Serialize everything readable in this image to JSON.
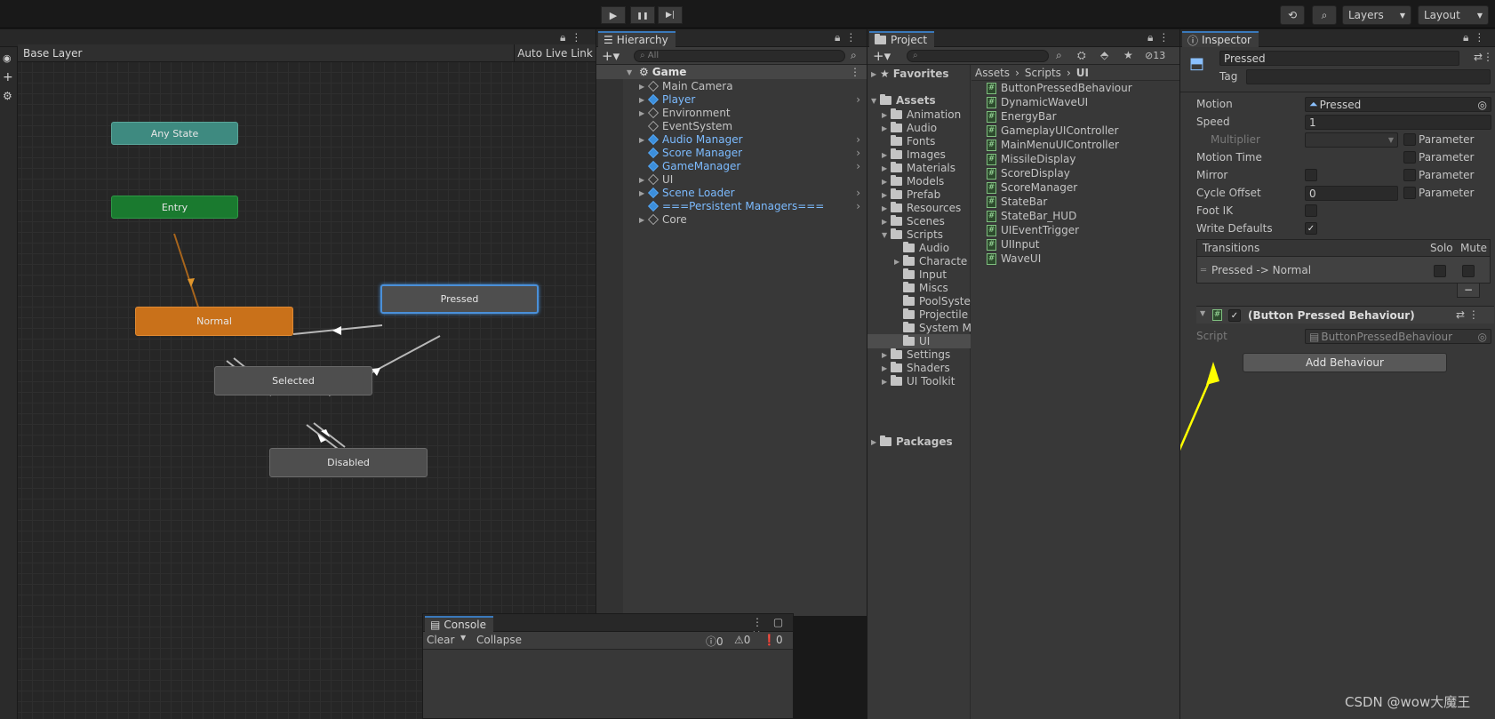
{
  "toolbar": {
    "play": "▶",
    "pause": "❚❚",
    "step": "▶|",
    "layers_label": "Layers",
    "layout_label": "Layout"
  },
  "animator": {
    "breadcrumb": "Base Layer",
    "auto_live_link": "Auto Live Link",
    "states": {
      "any_state": "Any State",
      "entry": "Entry",
      "normal": "Normal",
      "pressed": "Pressed",
      "selected": "Selected",
      "disabled": "Disabled"
    }
  },
  "hierarchy": {
    "tab": "Hierarchy",
    "search_placeholder": "All",
    "scene": "Game",
    "items": [
      {
        "label": "Main Camera",
        "prefab": false,
        "expandable": true,
        "has_arrow": false
      },
      {
        "label": "Player",
        "prefab": true,
        "expandable": true,
        "has_arrow": true
      },
      {
        "label": "Environment",
        "prefab": false,
        "expandable": true,
        "has_arrow": false
      },
      {
        "label": "EventSystem",
        "prefab": false,
        "expandable": false,
        "has_arrow": false
      },
      {
        "label": "Audio Manager",
        "prefab": true,
        "expandable": true,
        "has_arrow": true
      },
      {
        "label": "Score Manager",
        "prefab": true,
        "expandable": false,
        "has_arrow": true
      },
      {
        "label": "GameManager",
        "prefab": true,
        "expandable": false,
        "has_arrow": true
      },
      {
        "label": "UI",
        "prefab": false,
        "expandable": true,
        "has_arrow": false
      },
      {
        "label": "Scene Loader",
        "prefab": true,
        "expandable": true,
        "has_arrow": true
      },
      {
        "label": "===Persistent Managers===",
        "prefab": true,
        "expandable": false,
        "has_arrow": true
      },
      {
        "label": "Core",
        "prefab": false,
        "expandable": true,
        "has_arrow": false
      }
    ]
  },
  "project": {
    "tab": "Project",
    "hidden_count": "13",
    "favorites": "Favorites",
    "assets": "Assets",
    "folders": [
      {
        "label": "Animation",
        "indent": 1,
        "expandable": true
      },
      {
        "label": "Audio",
        "indent": 1,
        "expandable": true
      },
      {
        "label": "Fonts",
        "indent": 1,
        "expandable": false
      },
      {
        "label": "Images",
        "indent": 1,
        "expandable": true
      },
      {
        "label": "Materials",
        "indent": 1,
        "expandable": true
      },
      {
        "label": "Models",
        "indent": 1,
        "expandable": true
      },
      {
        "label": "Prefab",
        "indent": 1,
        "expandable": true
      },
      {
        "label": "Resources",
        "indent": 1,
        "expandable": true
      },
      {
        "label": "Scenes",
        "indent": 1,
        "expandable": true
      },
      {
        "label": "Scripts",
        "indent": 1,
        "expandable": true,
        "open": true
      },
      {
        "label": "Audio",
        "indent": 2,
        "expandable": false
      },
      {
        "label": "Characte",
        "indent": 2,
        "expandable": true
      },
      {
        "label": "Input",
        "indent": 2,
        "expandable": false
      },
      {
        "label": "Miscs",
        "indent": 2,
        "expandable": false
      },
      {
        "label": "PoolSyste",
        "indent": 2,
        "expandable": false
      },
      {
        "label": "Projectile",
        "indent": 2,
        "expandable": false
      },
      {
        "label": "System M",
        "indent": 2,
        "expandable": false
      },
      {
        "label": "UI",
        "indent": 2,
        "expandable": false,
        "selected": true
      },
      {
        "label": "Settings",
        "indent": 1,
        "expandable": true
      },
      {
        "label": "Shaders",
        "indent": 1,
        "expandable": true
      },
      {
        "label": "UI Toolkit",
        "indent": 1,
        "expandable": true
      }
    ],
    "packages": "Packages",
    "breadcrumb": [
      "Assets",
      "Scripts",
      "UI"
    ],
    "files": [
      "ButtonPressedBehaviour",
      "DynamicWaveUI",
      "EnergyBar",
      "GameplayUIController",
      "MainMenuUIController",
      "MissileDisplay",
      "ScoreDisplay",
      "ScoreManager",
      "StateBar",
      "StateBar_HUD",
      "UIEventTrigger",
      "UIInput",
      "WaveUI"
    ]
  },
  "inspector": {
    "tab": "Inspector",
    "name": "Pressed",
    "tag_label": "Tag",
    "motion_label": "Motion",
    "motion_value": "Pressed",
    "speed_label": "Speed",
    "speed_value": "1",
    "multiplier_label": "Multiplier",
    "motion_time_label": "Motion Time",
    "mirror_label": "Mirror",
    "cycle_offset_label": "Cycle Offset",
    "cycle_offset_value": "0",
    "foot_ik_label": "Foot IK",
    "write_defaults_label": "Write Defaults",
    "parameter_label": "Parameter",
    "transitions_label": "Transitions",
    "solo_label": "Solo",
    "mute_label": "Mute",
    "transition_item": "Pressed -> Normal",
    "minus": "−",
    "behaviour_title": "(Button Pressed Behaviour)",
    "script_label": "Script",
    "script_value": "ButtonPressedBehaviour",
    "add_behaviour": "Add Behaviour"
  },
  "console": {
    "tab": "Console",
    "clear": "Clear",
    "collapse": "Collapse",
    "info_count": "0",
    "warn_count": "0",
    "error_count": "0"
  },
  "watermark": "CSDN @wow大魔王",
  "colors": {
    "any_state": "#3e8a80",
    "entry": "#1a7a2f",
    "normal": "#c9711a",
    "state_gray": "#4e4e4e",
    "pressed_border": "#4a90d9",
    "arrow_highlight": "#ffff00",
    "prefab_blue": "#7cbbff"
  }
}
